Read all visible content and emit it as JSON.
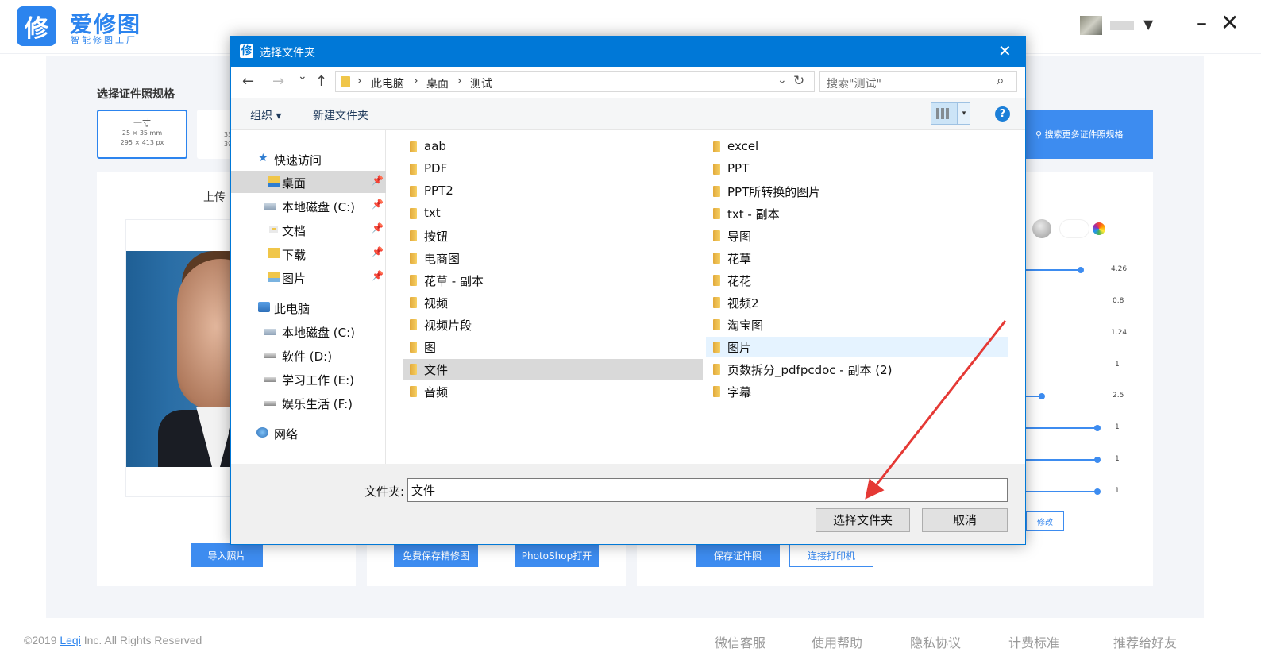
{
  "app": {
    "logo_glyph": "修",
    "name": "爱修图",
    "tagline": "智能修图工厂",
    "brand_color": "#2c84ee",
    "window_controls": {
      "minimize": "–",
      "close": "✕"
    },
    "user_caret": "▼"
  },
  "background": {
    "spec_section_title": "选择证件照规格",
    "spec_cards": [
      {
        "name": "一寸",
        "size_mm": "25 × 35 mm",
        "size_px": "295 × 413 px",
        "selected": true
      },
      {
        "name": "",
        "size_mm": "33",
        "size_px": "39"
      }
    ],
    "search_more_label": "搜索更多证件照规格",
    "upload_label": "上传",
    "sliders": [
      {
        "value": "4.26",
        "level": 0.82
      },
      {
        "value": "0.8"
      },
      {
        "value": "1.24"
      },
      {
        "value": "1"
      },
      {
        "value": "2.5",
        "level": 0.22
      },
      {
        "value": "1",
        "level": 1.0
      },
      {
        "value": "1",
        "level": 1.0
      },
      {
        "value": "1",
        "level": 1.0
      }
    ],
    "modify_label": "修改",
    "buttons": {
      "import_photo": "导入照片",
      "free_save": "免费保存精修图",
      "photoshop_open": "PhotoShop打开",
      "save_id_photo": "保存证件照",
      "connect_printer": "连接打印机"
    }
  },
  "footer": {
    "copyright_prefix": "©2019",
    "copyright_link": "Leqi",
    "copyright_suffix": "Inc. All Rights Reserved",
    "links": [
      "微信客服",
      "使用帮助",
      "隐私协议",
      "计费标准",
      "推荐给好友"
    ]
  },
  "dialog": {
    "title": "选择文件夹",
    "title_icon": "修",
    "close_label": "✕",
    "nav": {
      "back": "←",
      "forward": "→",
      "recent": "⌄",
      "up": "↑"
    },
    "address_crumbs": [
      "此电脑",
      "桌面",
      "测试"
    ],
    "address_sep": "›",
    "address_dropdown": "⌄",
    "refresh": "↻",
    "search_placeholder": "搜索\"测试\"",
    "search_icon": "⌕",
    "organize_label": "组织 ▾",
    "new_folder_label": "新建文件夹",
    "view_dropdown": "▾",
    "help_label": "?",
    "nav_pane": [
      {
        "label": "快速访问",
        "icon": "star-icon",
        "level": 0
      },
      {
        "label": "桌面",
        "icon": "desktop-folder-icon",
        "level": 1,
        "pinned": true,
        "selected": true
      },
      {
        "label": "本地磁盘 (C:)",
        "icon": "drive-icon",
        "level": 1,
        "pinned": true
      },
      {
        "label": "文档",
        "icon": "document-folder-icon",
        "level": 1,
        "pinned": true
      },
      {
        "label": "下载",
        "icon": "download-folder-icon",
        "level": 1,
        "pinned": true
      },
      {
        "label": "图片",
        "icon": "pictures-folder-icon",
        "level": 1,
        "pinned": true
      },
      {
        "label": "此电脑",
        "icon": "computer-icon",
        "level": 0
      },
      {
        "label": "本地磁盘 (C:)",
        "icon": "drive-icon",
        "level": 1
      },
      {
        "label": "软件 (D:)",
        "icon": "drive-icon",
        "level": 1
      },
      {
        "label": "学习工作 (E:)",
        "icon": "drive-icon",
        "level": 1
      },
      {
        "label": "娱乐生活 (F:)",
        "icon": "drive-icon",
        "level": 1
      },
      {
        "label": "网络",
        "icon": "network-icon",
        "level": 0
      }
    ],
    "pin_glyph": "📌",
    "folders_left": [
      "aab",
      "PDF",
      "PPT2",
      "txt",
      "按钮",
      "电商图",
      "花草 - 副本",
      "视频",
      "视频片段",
      "图",
      "文件",
      "音频"
    ],
    "folders_right": [
      "excel",
      "PPT",
      "PPT所转换的图片",
      "txt - 副本",
      "导图",
      "花草",
      "花花",
      "视频2",
      "淘宝图",
      "图片",
      "页数拆分_pdfpcdoc - 副本 (2)",
      "字幕"
    ],
    "selected_folder": "文件",
    "hovered_folder": "图片",
    "folder_field_label": "文件夹:",
    "folder_field_value": "文件",
    "select_button": "选择文件夹",
    "cancel_button": "取消",
    "annotation_color": "#e53935"
  }
}
